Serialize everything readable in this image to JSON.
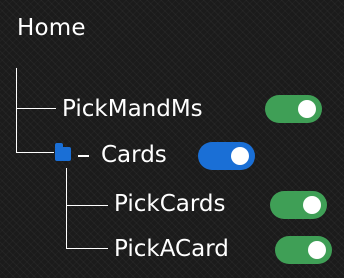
{
  "header": {
    "title": "Home"
  },
  "tree": {
    "nodes": [
      {
        "label": "PickMandMs",
        "toggle": {
          "on": true,
          "color": "#3f9f56"
        }
      },
      {
        "label": "Cards",
        "expanded": true,
        "expander_symbol": "-",
        "icon": "folder-icon",
        "folder_color": "#1a6fd6",
        "toggle": {
          "on": true,
          "color": "#1a6fd6"
        }
      },
      {
        "label": "PickCards",
        "toggle": {
          "on": true,
          "color": "#3f9f56"
        }
      },
      {
        "label": "PickACard",
        "toggle": {
          "on": true,
          "color": "#3f9f56"
        }
      }
    ]
  }
}
